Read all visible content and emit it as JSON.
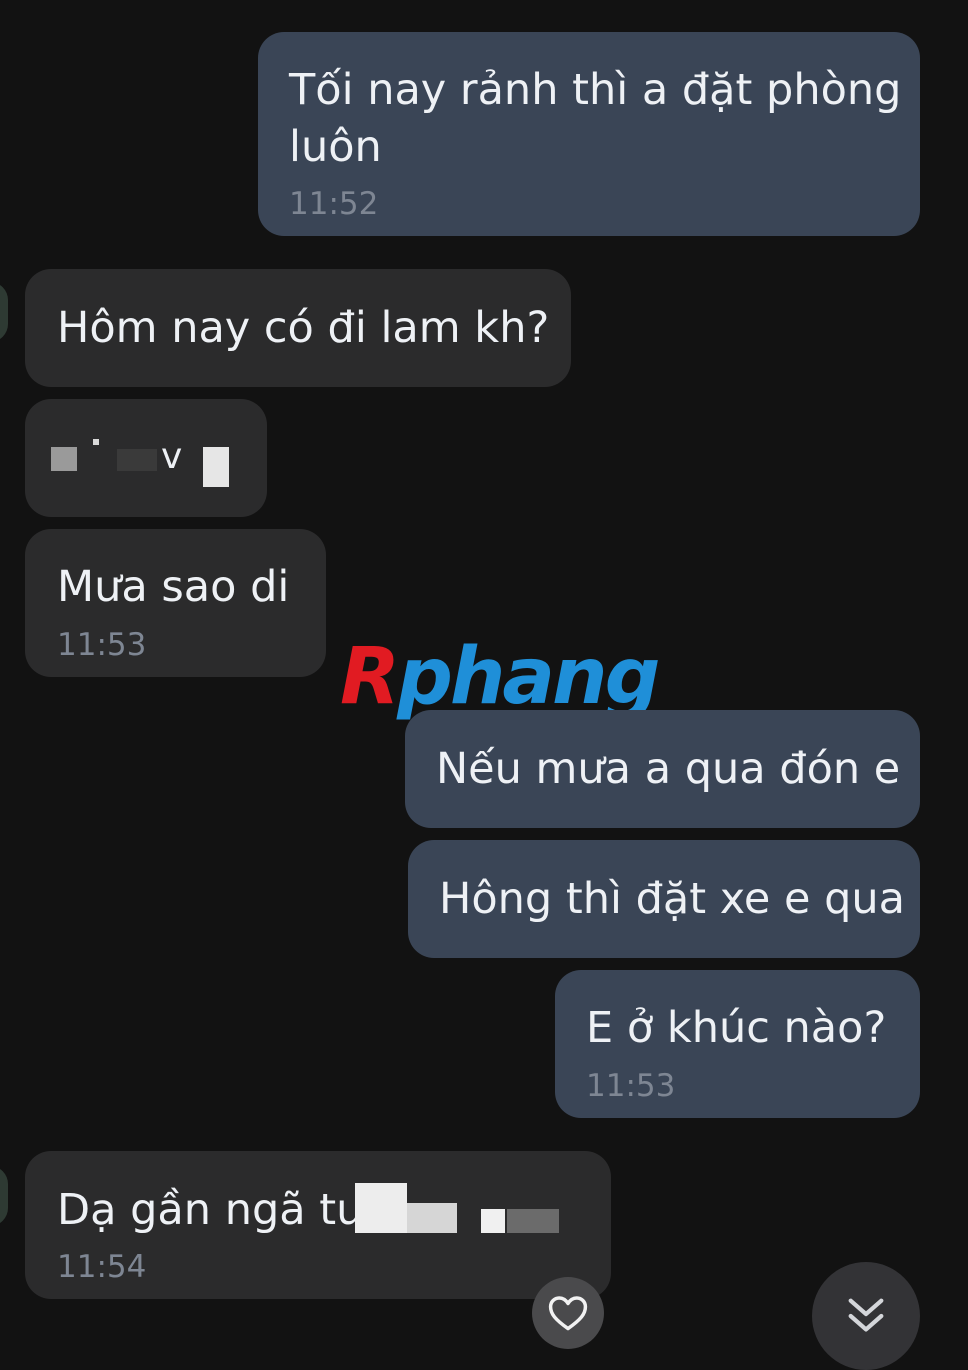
{
  "messages": [
    {
      "id": "m1",
      "direction": "sent",
      "lines": [
        "Tối nay rảnh thì a đặt phòng",
        "luôn"
      ],
      "time": "11:52"
    },
    {
      "id": "m2",
      "direction": "received",
      "text": "Hôm nay có đi lam kh?"
    },
    {
      "id": "m3",
      "direction": "received",
      "text": "v"
    },
    {
      "id": "m4",
      "direction": "received",
      "text": "Mưa sao di",
      "time": "11:53"
    },
    {
      "id": "m5",
      "direction": "sent",
      "text": "Nếu mưa a qua đón e"
    },
    {
      "id": "m6",
      "direction": "sent",
      "text": "Hông thì đặt xe e qua"
    },
    {
      "id": "m7",
      "direction": "sent",
      "text": "E ở khúc nào?",
      "time": "11:53"
    },
    {
      "id": "m8",
      "direction": "received",
      "text": "Dạ gần ngã tư",
      "time": "11:54"
    }
  ],
  "watermark": {
    "first": "R",
    "rest": "phang"
  },
  "icons": {
    "like": "heart-icon",
    "scroll": "double-chevron-down-icon"
  },
  "colors": {
    "background": "#121212",
    "sent_bubble": "#3a4556",
    "received_bubble": "#2b2b2c",
    "timestamp": "#7e8693",
    "watermark_red": "#e11b22",
    "watermark_blue": "#1f8fd8"
  }
}
